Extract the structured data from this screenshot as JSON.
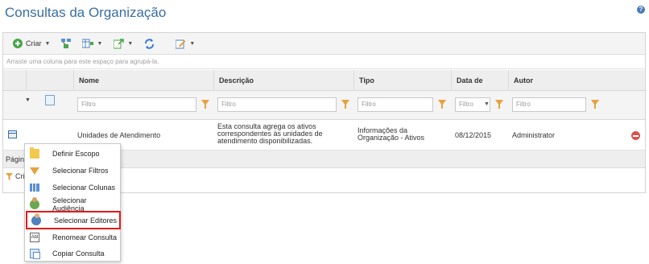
{
  "page": {
    "title": "Consultas da Organização",
    "help_icon": "help-icon"
  },
  "toolbar": {
    "create_label": "Criar",
    "icons": [
      "plus-icon",
      "columns-icon",
      "group-icon",
      "export-icon",
      "refresh-icon",
      "edit-icon"
    ]
  },
  "grid": {
    "group_hint": "Arraste uma coluna para este espaço para agrupá-la.",
    "columns": [
      "Nome",
      "Descrição",
      "Tipo",
      "Data de Atualização",
      "Autor"
    ],
    "filter_placeholder": "Filtro",
    "rows": [
      {
        "nome": "Unidades de Atendimento",
        "descricao": "Esta consulta agrega os ativos correspondentes às unidades de atendimento disponibilizadas.",
        "tipo": "Informações da Organização - Ativos",
        "data": "08/12/2015",
        "autor": "Administrator"
      }
    ],
    "pager_text": "Págin",
    "criteria_text": "Cria"
  },
  "context_menu": {
    "items": [
      {
        "label": "Definir Escopo",
        "icon": "folder-icon"
      },
      {
        "label": "Selecionar Filtros",
        "icon": "funnel-icon"
      },
      {
        "label": "Selecionar Colunas",
        "icon": "columns-icon"
      },
      {
        "label": "Selecionar Audiência",
        "icon": "audience-icon"
      },
      {
        "label": "Selecionar Editores",
        "icon": "editors-icon"
      },
      {
        "label": "Renomear Consulta",
        "icon": "rename-icon"
      },
      {
        "label": "Copiar Consulta",
        "icon": "copy-icon"
      }
    ],
    "highlighted": "Selecionar Editores"
  },
  "colors": {
    "title": "#3a6ea5",
    "highlight_border": "#e21b1b",
    "filter_icon": "#e6a23c",
    "delete": "#d9534f"
  }
}
